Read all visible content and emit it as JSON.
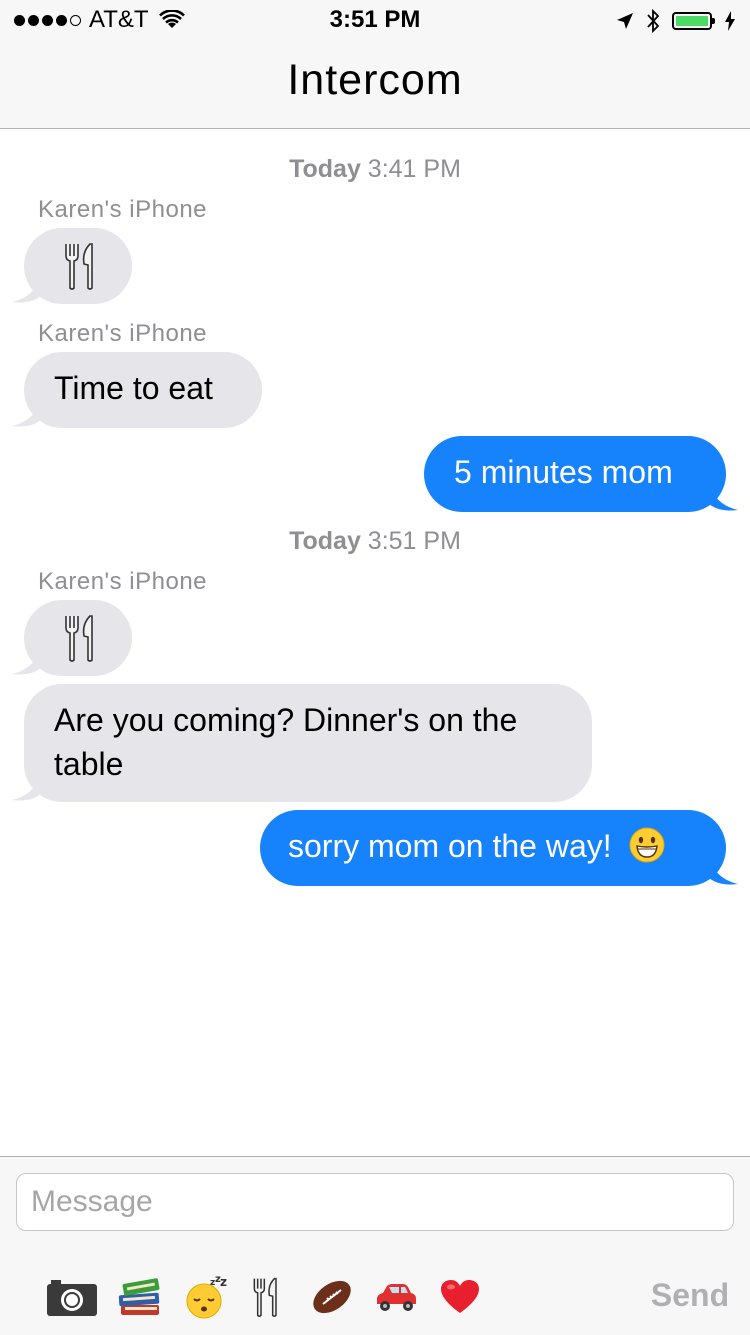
{
  "status_bar": {
    "carrier": "AT&T",
    "time": "3:51 PM",
    "battery_level": 1.0,
    "battery_color": "#4cd964"
  },
  "nav": {
    "title": "Intercom"
  },
  "conversation": {
    "timestamps": [
      {
        "day": "Today",
        "time": "3:41 PM"
      },
      {
        "day": "Today",
        "time": "3:51 PM"
      }
    ],
    "senders": [
      "Karen's iPhone",
      "Karen's iPhone",
      "Karen's iPhone"
    ],
    "messages": [
      {
        "direction": "incoming",
        "content": "fork-and-knife-emoji"
      },
      {
        "direction": "incoming",
        "text": "Time to eat"
      },
      {
        "direction": "outgoing",
        "text": "5 minutes mom"
      },
      {
        "direction": "incoming",
        "content": "fork-and-knife-emoji"
      },
      {
        "direction": "incoming",
        "text": "Are you coming? Dinner's on the table",
        "line1": "Are you coming? Dinner's on the",
        "line2": "table"
      },
      {
        "direction": "outgoing",
        "text": "sorry mom on the way!",
        "emoji": "grinning-face-emoji"
      }
    ],
    "incoming_color": "#e5e5ea",
    "outgoing_color": "#1682fb"
  },
  "composer": {
    "placeholder": "Message",
    "send_label": "Send",
    "quick_icons": [
      "camera-icon",
      "books-emoji",
      "sleeping-face-emoji",
      "fork-and-knife-emoji",
      "football-emoji",
      "car-emoji",
      "heart-emoji"
    ]
  }
}
